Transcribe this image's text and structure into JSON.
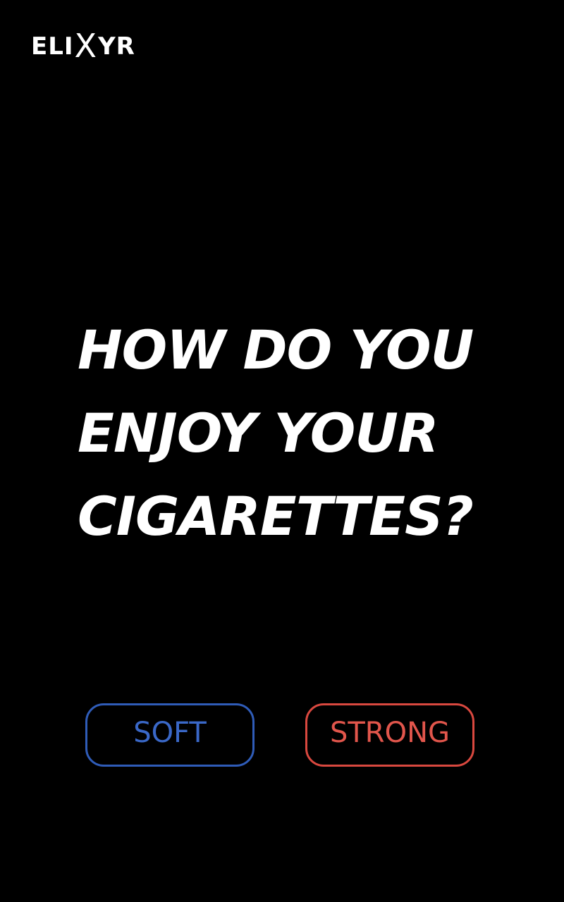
{
  "brand": {
    "logo_left": "ELI",
    "logo_x": "X",
    "logo_right": "YR"
  },
  "question": {
    "lines": [
      "HOW DO YOU",
      "ENJOY YOUR",
      "CIGARETTES?"
    ]
  },
  "choices": [
    {
      "label": "SOFT",
      "color": "#3a68c8"
    },
    {
      "label": "STRONG",
      "color": "#e2564c"
    }
  ],
  "colors": {
    "background": "#000000",
    "text": "#ffffff"
  }
}
